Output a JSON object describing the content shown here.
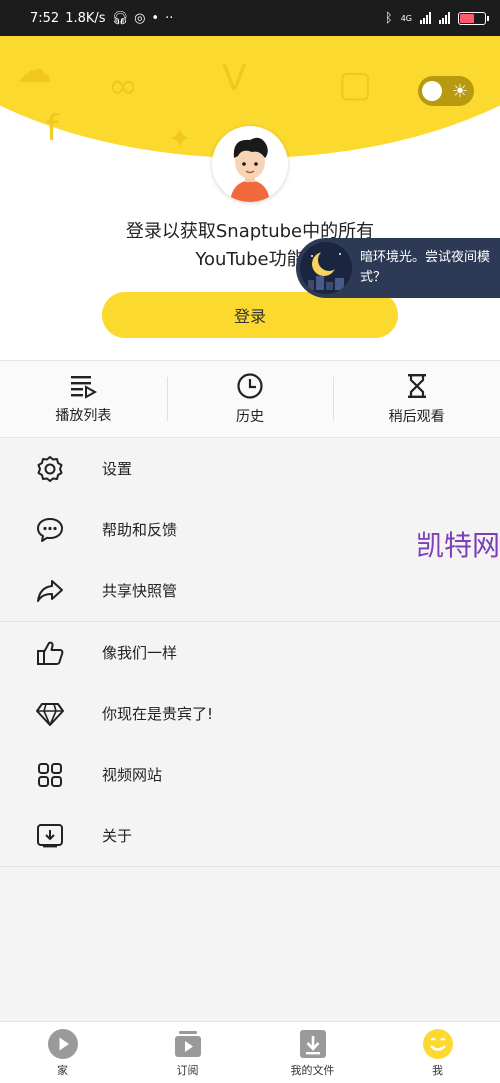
{
  "status_bar": {
    "time": "7:52",
    "speed": "1.8K/s",
    "network": "4G"
  },
  "header": {
    "prompt_line1": "登录以获取Snaptube中的所有",
    "prompt_line2": "YouTube功能",
    "login_button": "登录",
    "theme_toggle_icon": "sun-icon"
  },
  "tooltip": {
    "text": "暗环境光。尝试夜间模式？"
  },
  "quick_actions": [
    {
      "label": "播放列表",
      "icon": "playlist-icon"
    },
    {
      "label": "历史",
      "icon": "history-clock-icon"
    },
    {
      "label": "稍后观看",
      "icon": "hourglass-icon"
    }
  ],
  "menu_group1": [
    {
      "label": "设置",
      "icon": "gear-icon"
    },
    {
      "label": "帮助和反馈",
      "icon": "chat-bubble-icon"
    },
    {
      "label": "共享快照管",
      "icon": "share-arrow-icon"
    }
  ],
  "menu_group2": [
    {
      "label": "像我们一样",
      "icon": "thumbs-up-icon"
    },
    {
      "label": "你现在是贵宾了!",
      "icon": "diamond-icon"
    },
    {
      "label": "视频网站",
      "icon": "grid-apps-icon"
    },
    {
      "label": "关于",
      "icon": "about-download-icon"
    }
  ],
  "watermark": "凯特网",
  "bottom_nav": [
    {
      "label": "家",
      "icon": "play-circle-icon"
    },
    {
      "label": "订阅",
      "icon": "subscriptions-icon"
    },
    {
      "label": "我的文件",
      "icon": "download-file-icon"
    },
    {
      "label": "我",
      "icon": "smiley-icon"
    }
  ],
  "colors": {
    "accent_yellow": "#fcd92e",
    "status_bar": "#1c1c1c",
    "tooltip_bg": "#2c3a55",
    "watermark": "#7b3fb8"
  }
}
